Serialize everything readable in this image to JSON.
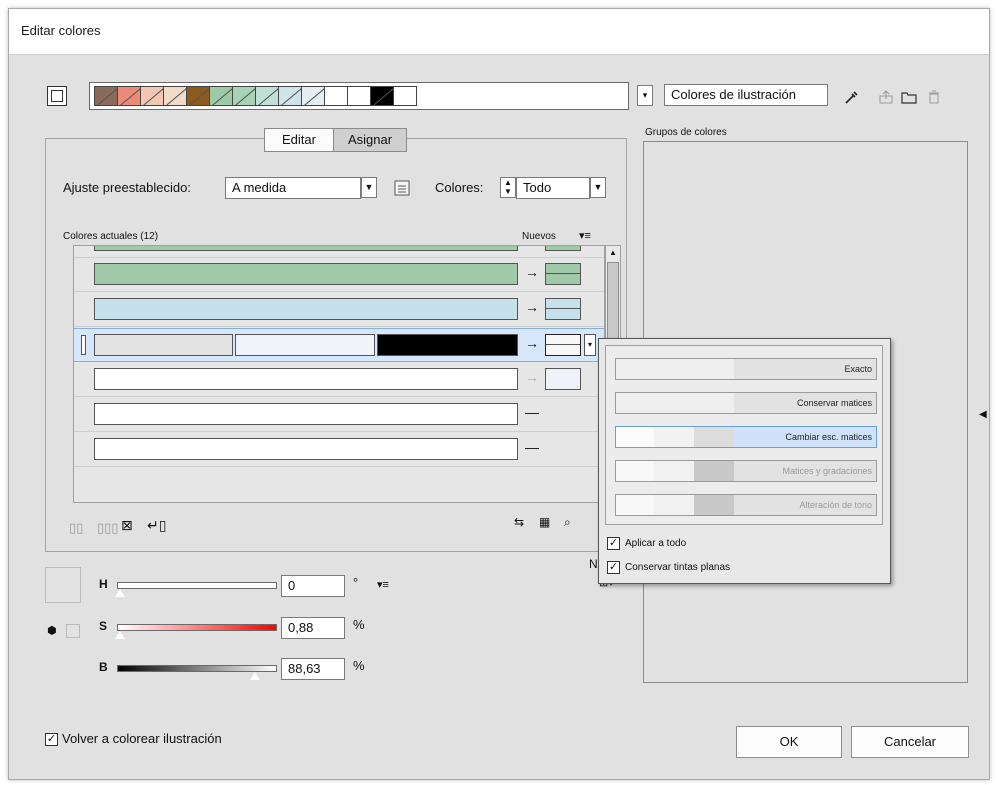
{
  "window": {
    "title": "Editar colores"
  },
  "top_bar": {
    "group_name": "Colores de ilustración",
    "dropdown_arrow": "▾",
    "strip_colors": [
      "#8a6a5a",
      "#ec8a78",
      "#f2c8b4",
      "#f1dcc9",
      "#8b5a1e",
      "#9ccaa6",
      "#a8d2b6",
      "#bfe0d6",
      "#cfe4ea",
      "#e5eef3",
      "#ffffff",
      "#ffffff",
      "#000000",
      "#ffffff"
    ],
    "icons": [
      "eyedropper-icon",
      "save-group-icon",
      "folder-icon",
      "trash-icon"
    ]
  },
  "tabs": {
    "editar": "Editar",
    "asignar": "Asignar"
  },
  "preset": {
    "label": "Ajuste preestablecido:",
    "value": "A medida",
    "colors_label": "Colores:",
    "colors_value": "Todo"
  },
  "list": {
    "header_current": "Colores actuales (12)",
    "header_new": "Nuevos",
    "rows": [
      {
        "bars": [
          "#9fc9a8"
        ],
        "arrow": "→",
        "new_color": "#9fc9a8"
      },
      {
        "bars": [
          "#c7e1ec"
        ],
        "arrow": "→",
        "new_color": "#c7e1ec"
      },
      {
        "bars": [
          "#e3e3e3",
          "#f1f3fb",
          "#000000"
        ],
        "arrow": "→",
        "new_color": "#f7f7f7",
        "selected": true
      },
      {
        "bars": [
          "#ffffff"
        ],
        "arrow": "→",
        "new_color": "#eef2f8"
      },
      {
        "bars": [
          "#ffffff"
        ],
        "arrow": "—"
      },
      {
        "bars": [
          "#ffffff"
        ],
        "arrow": "—"
      }
    ]
  },
  "popup": {
    "methods": [
      {
        "label": "Exacto",
        "state": "normal"
      },
      {
        "label": "Conservar matices",
        "state": "normal"
      },
      {
        "label": "Cambiar esc. matices",
        "state": "selected"
      },
      {
        "label": "Matices y gradaciones",
        "state": "disabled"
      },
      {
        "label": "Alteración de tono",
        "state": "disabled"
      }
    ],
    "apply_all": "Aplicar a todo",
    "preserve_spot": "Conservar tintas planas",
    "apply_all_checked": true,
    "preserve_spot_checked": true
  },
  "sliders": {
    "h": {
      "label": "H",
      "value": "0",
      "unit": "°"
    },
    "s": {
      "label": "S",
      "value": "0,88",
      "unit": "%"
    },
    "b": {
      "label": "B",
      "value": "88,63",
      "unit": "%"
    }
  },
  "right_panel": {
    "title": "Grupos de colores"
  },
  "footer": {
    "recolor_label": "Volver a colorear ilustración",
    "recolor_checked": true,
    "ok": "OK",
    "cancel": "Cancelar"
  },
  "misc": {
    "partial_label": "N"
  }
}
